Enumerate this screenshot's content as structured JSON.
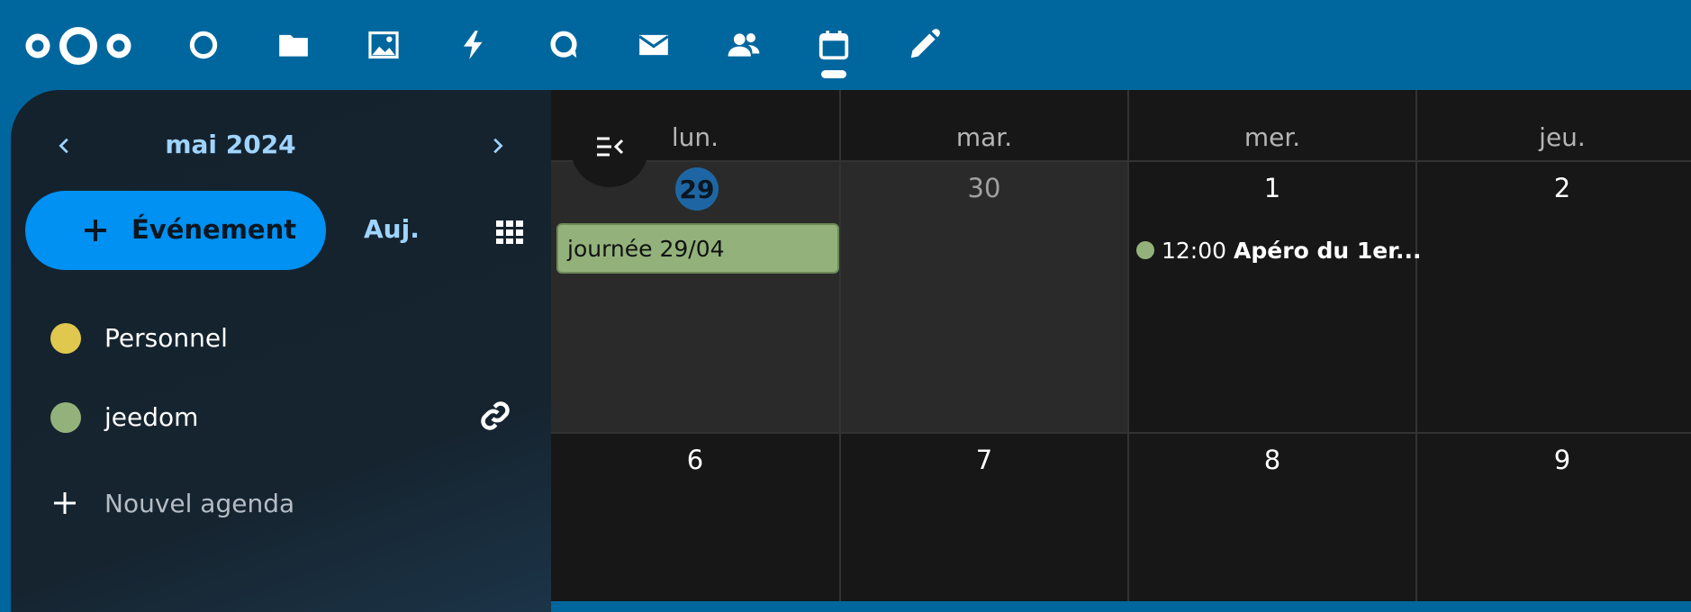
{
  "header": {
    "apps": [
      {
        "name": "dashboard-icon"
      },
      {
        "name": "files-icon"
      },
      {
        "name": "photos-icon"
      },
      {
        "name": "activity-icon"
      },
      {
        "name": "talk-icon"
      },
      {
        "name": "mail-icon"
      },
      {
        "name": "contacts-icon"
      },
      {
        "name": "calendar-icon",
        "active": true
      },
      {
        "name": "notes-icon"
      }
    ]
  },
  "sidebar": {
    "month_title": "mai 2024",
    "new_event_label": "Événement",
    "today_label": "Auj.",
    "calendars": [
      {
        "label": "Personnel",
        "color": "#e0c84f",
        "shared": false
      },
      {
        "label": "jeedom",
        "color": "#93b27b",
        "shared": true
      }
    ],
    "add_calendar_label": "Nouvel agenda"
  },
  "grid": {
    "weekdays": [
      "lun.",
      "mar.",
      "mer.",
      "jeu."
    ],
    "week1": [
      "29",
      "30",
      "1",
      "2"
    ],
    "week2": [
      "6",
      "7",
      "8",
      "9"
    ],
    "allday_event": "journée 29/04",
    "timed_event": {
      "time": "12:00",
      "title": "Apéro du 1er..."
    }
  },
  "colors": {
    "header": "#00679e",
    "accent": "#0091f2",
    "accent_text": "#9fd4ff"
  }
}
